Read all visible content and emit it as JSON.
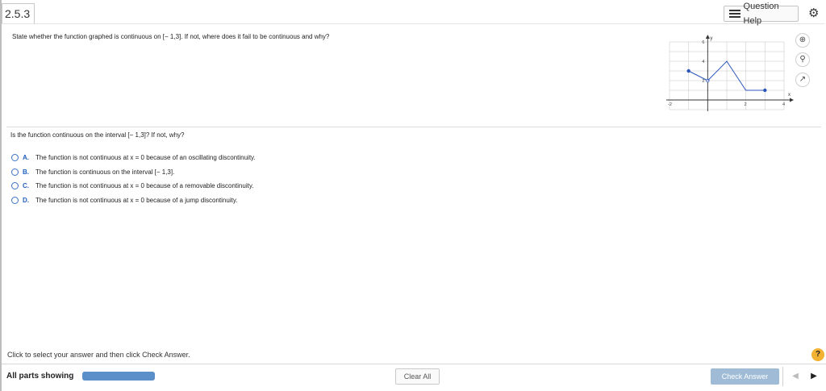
{
  "header": {
    "question_number": "2.5.3",
    "help_label": "Question Help",
    "icons": {
      "help": "list-icon",
      "settings": "gear-icon"
    }
  },
  "statement": "State whether the function graphed is continuous on [− 1,3]. If not, where does it fail to be continuous and why?",
  "graph_tools": [
    "zoom-in-icon",
    "zoom-out-icon",
    "expand-icon"
  ],
  "chart_data": {
    "type": "line",
    "xlabel": "x",
    "ylabel": "y",
    "xlim": [
      -2,
      4
    ],
    "ylim": [
      -1,
      6
    ],
    "x_ticks": [
      "-2",
      "2",
      "4"
    ],
    "y_ticks": [
      "2",
      "4",
      "6"
    ],
    "grid": true,
    "series": [
      {
        "x": [
          -1,
          0
        ],
        "y": [
          3,
          2
        ],
        "endpoints": [
          {
            "x": -1,
            "y": 3,
            "filled": true
          },
          {
            "x": 0,
            "y": 2,
            "filled": false
          }
        ]
      },
      {
        "x": [
          0,
          1,
          2,
          3
        ],
        "y": [
          2,
          4,
          1,
          1
        ],
        "endpoints": [
          {
            "x": 3,
            "y": 1,
            "filled": true
          }
        ]
      }
    ],
    "line_color": "#2c55b8"
  },
  "question": "Is the function continuous on the interval [− 1,3]? If not, why?",
  "options": [
    {
      "letter": "A.",
      "text": "The function is not continuous at x = 0 because of an oscillating discontinuity."
    },
    {
      "letter": "B.",
      "text": "The function is continuous on the interval [− 1,3]."
    },
    {
      "letter": "C.",
      "text": "The function is not continuous at x = 0 because of a removable discontinuity."
    },
    {
      "letter": "D.",
      "text": "The function is not continuous at x = 0 because of a jump discontinuity."
    }
  ],
  "hint": "Click to select your answer and then click Check Answer.",
  "help_badge": "?",
  "footer": {
    "parts_label": "All parts showing",
    "progress": 1.0,
    "clear_label": "Clear All",
    "check_label": "Check Answer",
    "nav": {
      "prev": "◀",
      "next": "▶"
    }
  }
}
